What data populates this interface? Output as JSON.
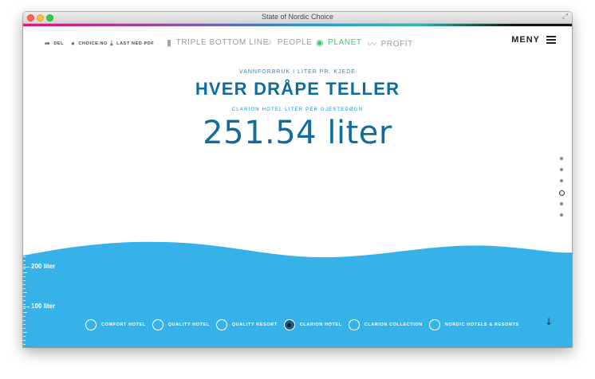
{
  "window": {
    "title": "State of Nordic Choice"
  },
  "nav": {
    "share": {
      "label": "DEL",
      "icon": "share-icon"
    },
    "site": {
      "label": "CHOICE.NO",
      "icon": "globe-icon"
    },
    "pdf": {
      "label": "LAST NED PDF",
      "icon": "download-icon"
    },
    "sections": [
      {
        "label": "TRIPLE BOTTOM LINE",
        "icon": "bar-chart-icon",
        "active": false
      },
      {
        "label": "PEOPLE",
        "icon": "people-icon",
        "active": false
      },
      {
        "label": "PLANET",
        "icon": "globe-icon",
        "active": true
      },
      {
        "label": "PROFIT",
        "icon": "trend-icon",
        "active": false
      }
    ],
    "menu_label": "MENY"
  },
  "main": {
    "subtitle": "VANNFORBRUK I LITER PR. KJEDE",
    "title": "HVER DRÅPE TELLER",
    "metric_label": "CLARION HOTEL LITER PER GJESTEDØGN",
    "metric_value": "251.54 liter"
  },
  "scale": {
    "label_200": "200 liter",
    "label_100": "100 liter"
  },
  "chains": [
    {
      "label": "COMFORT HOTEL",
      "selected": false
    },
    {
      "label": "QUALITY HOTEL",
      "selected": false
    },
    {
      "label": "QUALITY RESORT",
      "selected": false
    },
    {
      "label": "CLARION HOTEL",
      "selected": true
    },
    {
      "label": "CLARION COLLECTION",
      "selected": false
    },
    {
      "label": "NORDIC HOTELS & RESORTS",
      "selected": false
    }
  ],
  "page_dots": {
    "count": 6,
    "active_index": 3
  },
  "scroll_down_icon": "arrow-down-icon",
  "colors": {
    "water": "#36b2e8",
    "accent": "#0e6d9e",
    "planet": "#3cc46f"
  }
}
